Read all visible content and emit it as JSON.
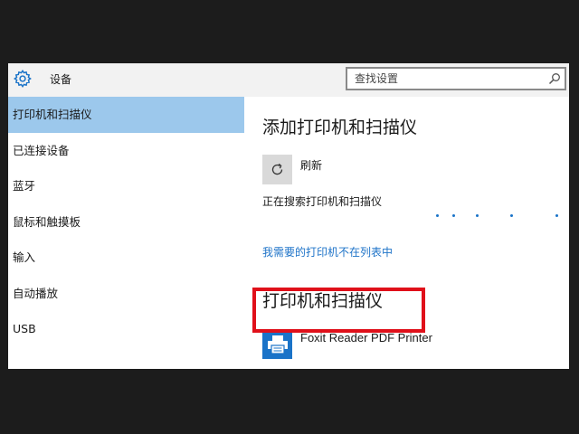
{
  "titlebar": {
    "title": "设备"
  },
  "search": {
    "placeholder": "查找设置"
  },
  "sidebar": {
    "items": [
      {
        "label": "打印机和扫描仪",
        "active": true
      },
      {
        "label": "已连接设备"
      },
      {
        "label": "蓝牙"
      },
      {
        "label": "鼠标和触摸板"
      },
      {
        "label": "输入"
      },
      {
        "label": "自动播放"
      },
      {
        "label": "USB"
      }
    ]
  },
  "main": {
    "add_heading": "添加打印机和扫描仪",
    "refresh_label": "刷新",
    "searching_text": "正在搜索打印机和扫描仪",
    "missing_link": "我需要的打印机不在列表中",
    "printers_heading": "打印机和扫描仪",
    "printers": [
      {
        "name": "Foxit Reader PDF Printer"
      }
    ]
  },
  "colors": {
    "accent": "#1a73c8",
    "sidebar_active": "#9cc8ec",
    "highlight": "#e0101a"
  },
  "icons": {
    "settings": "gear-icon",
    "search": "search-icon",
    "refresh": "refresh-icon",
    "printer": "printer-icon"
  }
}
